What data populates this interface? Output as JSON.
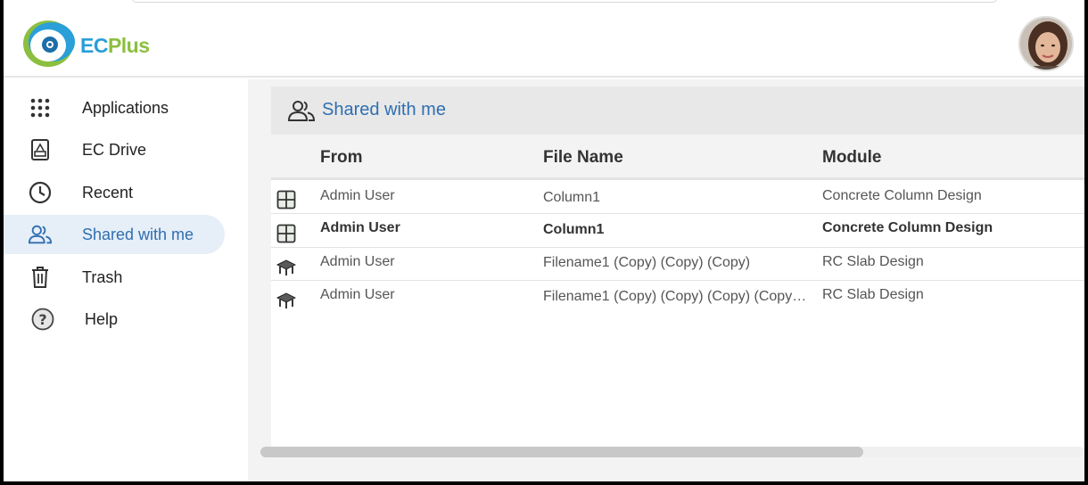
{
  "app": {
    "brand_ec": "EC",
    "brand_plus": "Plus"
  },
  "sidebar": {
    "items": [
      {
        "label": "Applications",
        "icon": "apps-grid-icon"
      },
      {
        "label": "EC Drive",
        "icon": "drive-icon"
      },
      {
        "label": "Recent",
        "icon": "clock-icon"
      },
      {
        "label": "Shared with me",
        "icon": "people-icon",
        "active": true
      },
      {
        "label": "Trash",
        "icon": "trash-icon"
      },
      {
        "label": "Help",
        "icon": "help-icon"
      }
    ]
  },
  "main": {
    "title": "Shared with me",
    "columns": [
      "From",
      "File Name",
      "Module"
    ],
    "rows": [
      {
        "from": "Admin User",
        "file": "Column1",
        "module": "Concrete Column Design",
        "icon": "column-module-icon",
        "bold": false
      },
      {
        "from": "Admin User",
        "file": "Column1",
        "module": "Concrete Column Design",
        "icon": "column-module-icon",
        "bold": true
      },
      {
        "from": "Admin User",
        "file": "Filename1 (Copy) (Copy) (Copy)",
        "module": "RC Slab Design",
        "icon": "slab-module-icon",
        "bold": false
      },
      {
        "from": "Admin User",
        "file": "Filename1 (Copy) (Copy) (Copy) (Copy…",
        "module": "RC Slab Design",
        "icon": "slab-module-icon",
        "bold": false
      }
    ]
  },
  "colors": {
    "accent": "#2f6fb1",
    "active_bg": "#e6eef8",
    "brand_blue": "#2a9fd8",
    "brand_green": "#8cbf3f"
  }
}
